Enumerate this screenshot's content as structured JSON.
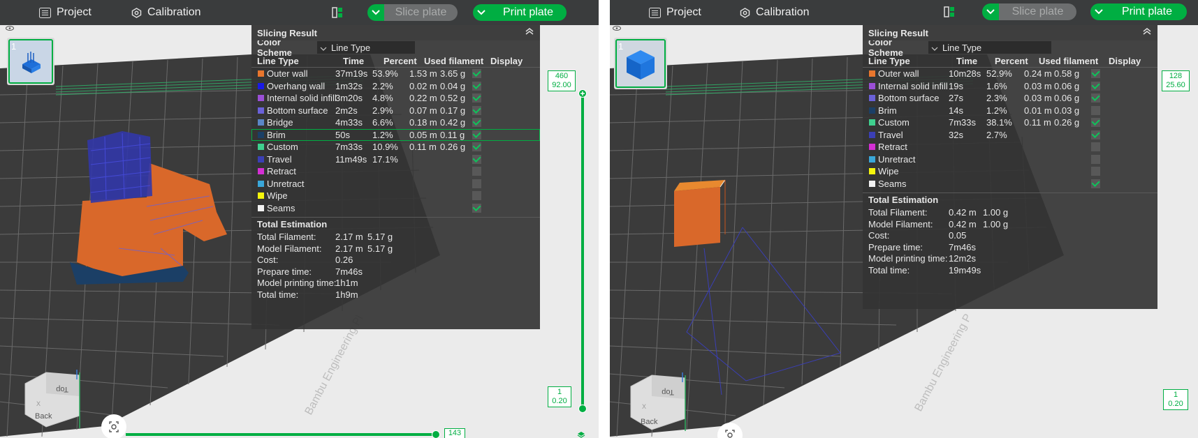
{
  "left": {
    "topbar": {
      "project_label": "Project",
      "calibration_label": "Calibration",
      "slice_label": "Slice plate",
      "print_label": "Print plate"
    },
    "plate_number": "1",
    "panel": {
      "title": "Slicing Result",
      "color_scheme_label": "Color Scheme",
      "color_scheme_value": "Line Type",
      "headers": {
        "line_type": "Line Type",
        "time": "Time",
        "percent": "Percent",
        "used": "Used filament",
        "display": "Display"
      },
      "rows": [
        {
          "name": "Outer wall",
          "color": "#e8762d",
          "time": "37m19s",
          "percent": "53.9%",
          "meters": "1.53 m",
          "grams": "3.65 g",
          "display": true
        },
        {
          "name": "Overhang wall",
          "color": "#1a1ae6",
          "time": "1m32s",
          "percent": "2.2%",
          "meters": "0.02 m",
          "grams": "0.04 g",
          "display": true
        },
        {
          "name": "Internal solid infill",
          "color": "#9b4fd6",
          "time": "3m20s",
          "percent": "4.8%",
          "meters": "0.22 m",
          "grams": "0.52 g",
          "display": true
        },
        {
          "name": "Bottom surface",
          "color": "#6a61d8",
          "time": "2m2s",
          "percent": "2.9%",
          "meters": "0.07 m",
          "grams": "0.17 g",
          "display": true
        },
        {
          "name": "Bridge",
          "color": "#5b86c7",
          "time": "4m33s",
          "percent": "6.6%",
          "meters": "0.18 m",
          "grams": "0.42 g",
          "display": true
        },
        {
          "name": "Brim",
          "color": "#1b3f66",
          "time": "50s",
          "percent": "1.2%",
          "meters": "0.05 m",
          "grams": "0.11 g",
          "display": true
        },
        {
          "name": "Custom",
          "color": "#3fcf8e",
          "time": "7m33s",
          "percent": "10.9%",
          "meters": "0.11 m",
          "grams": "0.26 g",
          "display": true
        },
        {
          "name": "Travel",
          "color": "#3b3fb5",
          "time": "11m49s",
          "percent": "17.1%",
          "meters": "",
          "grams": "",
          "display": true
        },
        {
          "name": "Retract",
          "color": "#d42fd4",
          "time": "",
          "percent": "",
          "meters": "",
          "grams": "",
          "display": false
        },
        {
          "name": "Unretract",
          "color": "#3aa7d9",
          "time": "",
          "percent": "",
          "meters": "",
          "grams": "",
          "display": false
        },
        {
          "name": "Wipe",
          "color": "#f5f50c",
          "time": "",
          "percent": "",
          "meters": "",
          "grams": "",
          "display": false
        },
        {
          "name": "Seams",
          "color": "#f2f2f2",
          "time": "",
          "percent": "",
          "meters": "",
          "grams": "",
          "display": true
        }
      ],
      "total_title": "Total Estimation",
      "totals": [
        {
          "label": "Total Filament:",
          "v1": "2.17 m",
          "v2": "5.17 g"
        },
        {
          "label": "Model Filament:",
          "v1": "2.17 m",
          "v2": "5.17 g"
        },
        {
          "label": "Cost:",
          "v1": "0.26",
          "v2": ""
        },
        {
          "label": "Prepare time:",
          "v1": "7m46s",
          "v2": ""
        },
        {
          "label": "Model printing time:",
          "v1": "1h1m",
          "v2": ""
        },
        {
          "label": "Total time:",
          "v1": "1h9m",
          "v2": ""
        }
      ]
    },
    "layer_top": {
      "a": "460",
      "b": "92.00"
    },
    "layer_bottom": {
      "a": "1",
      "b": "0.20"
    },
    "move_value": "143",
    "bed_text": "Bambu Engineering Pl",
    "viewcube": {
      "top": "Top",
      "back": "Back",
      "x": "X"
    }
  },
  "right": {
    "topbar": {
      "project_label": "Project",
      "calibration_label": "Calibration",
      "slice_label": "Slice plate",
      "print_label": "Print plate"
    },
    "plate_number": "1",
    "panel": {
      "title": "Slicing Result",
      "color_scheme_label": "Color Scheme",
      "color_scheme_value": "Line Type",
      "headers": {
        "line_type": "Line Type",
        "time": "Time",
        "percent": "Percent",
        "used": "Used filament",
        "display": "Display"
      },
      "rows": [
        {
          "name": "Outer wall",
          "color": "#e8762d",
          "time": "10m28s",
          "percent": "52.9%",
          "meters": "0.24 m",
          "grams": "0.58 g",
          "display": true
        },
        {
          "name": "Internal solid infill",
          "color": "#9b4fd6",
          "time": "19s",
          "percent": "1.6%",
          "meters": "0.03 m",
          "grams": "0.06 g",
          "display": true
        },
        {
          "name": "Bottom surface",
          "color": "#6a61d8",
          "time": "27s",
          "percent": "2.3%",
          "meters": "0.03 m",
          "grams": "0.06 g",
          "display": true
        },
        {
          "name": "Brim",
          "color": "#1b3f66",
          "time": "14s",
          "percent": "1.2%",
          "meters": "0.01 m",
          "grams": "0.03 g",
          "display": false
        },
        {
          "name": "Custom",
          "color": "#3fcf8e",
          "time": "7m33s",
          "percent": "38.1%",
          "meters": "0.11 m",
          "grams": "0.26 g",
          "display": true
        },
        {
          "name": "Travel",
          "color": "#3b3fb5",
          "time": "32s",
          "percent": "2.7%",
          "meters": "",
          "grams": "",
          "display": true
        },
        {
          "name": "Retract",
          "color": "#d42fd4",
          "time": "",
          "percent": "",
          "meters": "",
          "grams": "",
          "display": false
        },
        {
          "name": "Unretract",
          "color": "#3aa7d9",
          "time": "",
          "percent": "",
          "meters": "",
          "grams": "",
          "display": false
        },
        {
          "name": "Wipe",
          "color": "#f5f50c",
          "time": "",
          "percent": "",
          "meters": "",
          "grams": "",
          "display": false
        },
        {
          "name": "Seams",
          "color": "#f2f2f2",
          "time": "",
          "percent": "",
          "meters": "",
          "grams": "",
          "display": true
        }
      ],
      "total_title": "Total Estimation",
      "totals": [
        {
          "label": "Total Filament:",
          "v1": "0.42 m",
          "v2": "1.00 g"
        },
        {
          "label": "Model Filament:",
          "v1": "0.42 m",
          "v2": "1.00 g"
        },
        {
          "label": "Cost:",
          "v1": "0.05",
          "v2": ""
        },
        {
          "label": "Prepare time:",
          "v1": "7m46s",
          "v2": ""
        },
        {
          "label": "Model printing time:",
          "v1": "12m2s",
          "v2": ""
        },
        {
          "label": "Total time:",
          "v1": "19m49s",
          "v2": ""
        }
      ]
    },
    "layer_top": {
      "a": "128",
      "b": "25.60"
    },
    "layer_bottom": {
      "a": "1",
      "b": "0.20"
    },
    "bed_text": "Bambu Engineering P",
    "viewcube": {
      "top": "Top",
      "back": "Back",
      "x": "X"
    }
  },
  "colors": {
    "accent": "#00ae42",
    "topbar": "#3a3c3d",
    "panel": "#343434",
    "bed": "#3a3a3a"
  },
  "icons": [
    "project-icon",
    "calibration-icon",
    "plate-layout-icon",
    "chevron-down-icon",
    "collapse-icon",
    "eye-icon",
    "camera-icon",
    "layers-icon"
  ]
}
